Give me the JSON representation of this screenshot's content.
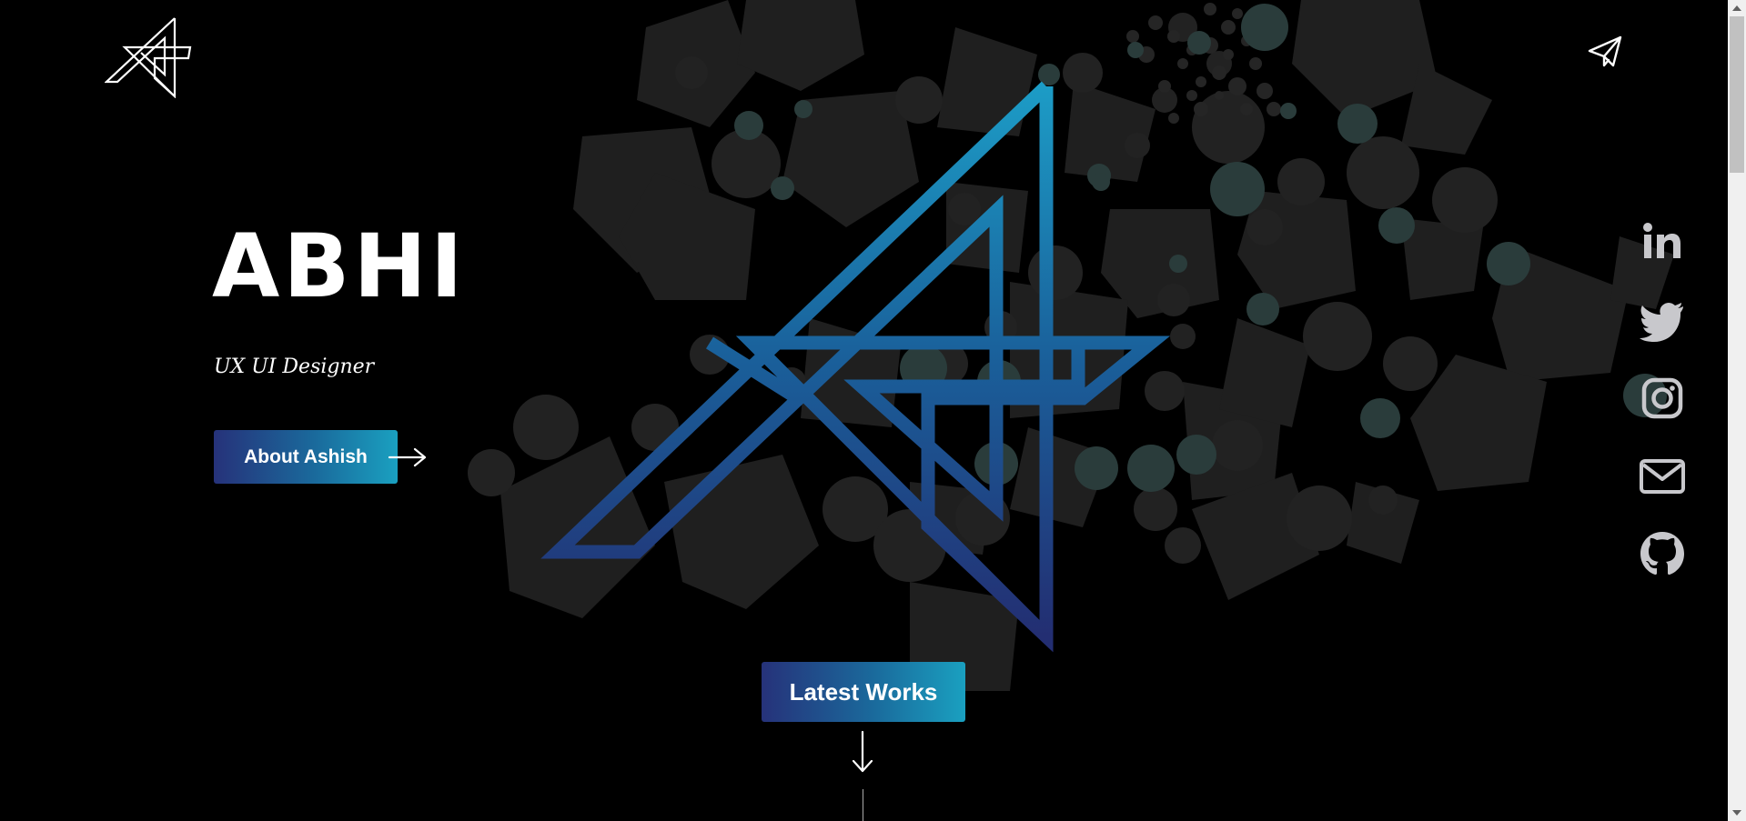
{
  "header": {
    "logo_icon": "ashish-logo-icon",
    "contact_icon": "paper-plane-icon"
  },
  "hero": {
    "title": "ABHI",
    "subtitle": "UX UI Designer",
    "about_button_label": "About Ashish",
    "about_arrow_icon": "arrow-right-icon"
  },
  "works": {
    "button_label": "Latest Works",
    "arrow_icon": "arrow-down-icon"
  },
  "social": [
    {
      "name": "linkedin",
      "icon": "linkedin-icon"
    },
    {
      "name": "twitter",
      "icon": "twitter-icon"
    },
    {
      "name": "instagram",
      "icon": "instagram-icon"
    },
    {
      "name": "email",
      "icon": "mail-icon"
    },
    {
      "name": "github",
      "icon": "github-icon"
    }
  ],
  "colors": {
    "background": "#000000",
    "accent_start": "#26327a",
    "accent_end": "#1aa0c0",
    "social_icon": "#c8c8cc",
    "shape_fill": "#1f1f1f",
    "teal_circle": "#2a3c3b"
  }
}
